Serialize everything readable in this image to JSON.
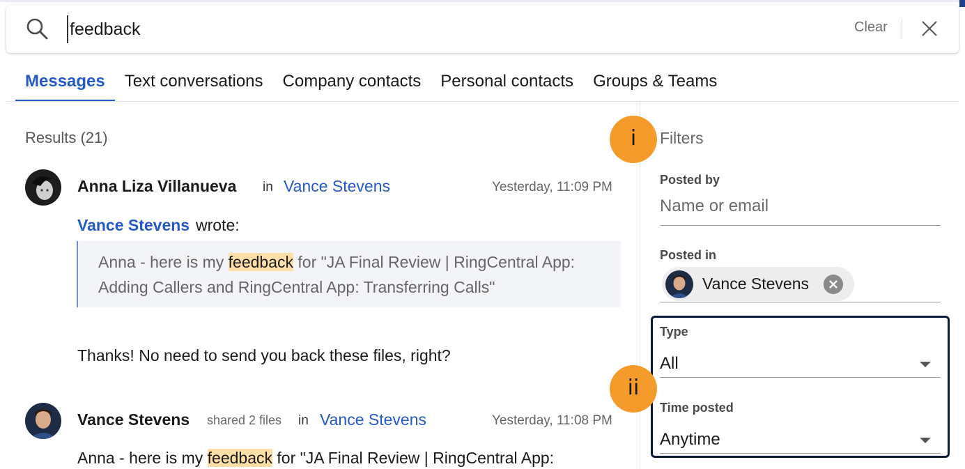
{
  "search": {
    "query": "feedback",
    "clear_label": "Clear"
  },
  "tabs": [
    {
      "label": "Messages",
      "active": true
    },
    {
      "label": "Text conversations"
    },
    {
      "label": "Company contacts"
    },
    {
      "label": "Personal contacts"
    },
    {
      "label": "Groups & Teams"
    }
  ],
  "results": {
    "title": "Results (21)",
    "items": [
      {
        "sender": "Anna Liza Villanueva",
        "in_label": "in",
        "conversation": "Vance Stevens",
        "timestamp": "Yesterday, 11:09 PM",
        "quote_author": "Vance Stevens",
        "quote_author_suffix": "wrote:",
        "quote_line1_before": "Anna - here is my ",
        "quote_highlight": "feedback",
        "quote_line1_after": " for \"JA Final Review | RingCentral App:",
        "quote_line2": "Adding Callers and RingCentral App: Transferring Calls\"",
        "message": "Thanks! No need to send you back these files, right?"
      },
      {
        "sender": "Vance Stevens",
        "action": "shared 2 files",
        "in_label": "in",
        "conversation": "Vance Stevens",
        "timestamp": "Yesterday, 11:08 PM",
        "text_before": "Anna - here is my ",
        "highlight": "feedback",
        "text_after": " for \"JA Final Review | RingCentral App:"
      }
    ]
  },
  "filters": {
    "title": "Filters",
    "posted_by_label": "Posted by",
    "posted_by_placeholder": "Name or email",
    "posted_in_label": "Posted in",
    "posted_in_chip": "Vance Stevens",
    "type_label": "Type",
    "type_value": "All",
    "time_label": "Time posted",
    "time_value": "Anytime"
  },
  "callouts": {
    "one": "i",
    "two": "ii"
  },
  "colors": {
    "accent": "#2559c7",
    "highlight": "#ffdfa8",
    "callout": "#f59b2b"
  }
}
